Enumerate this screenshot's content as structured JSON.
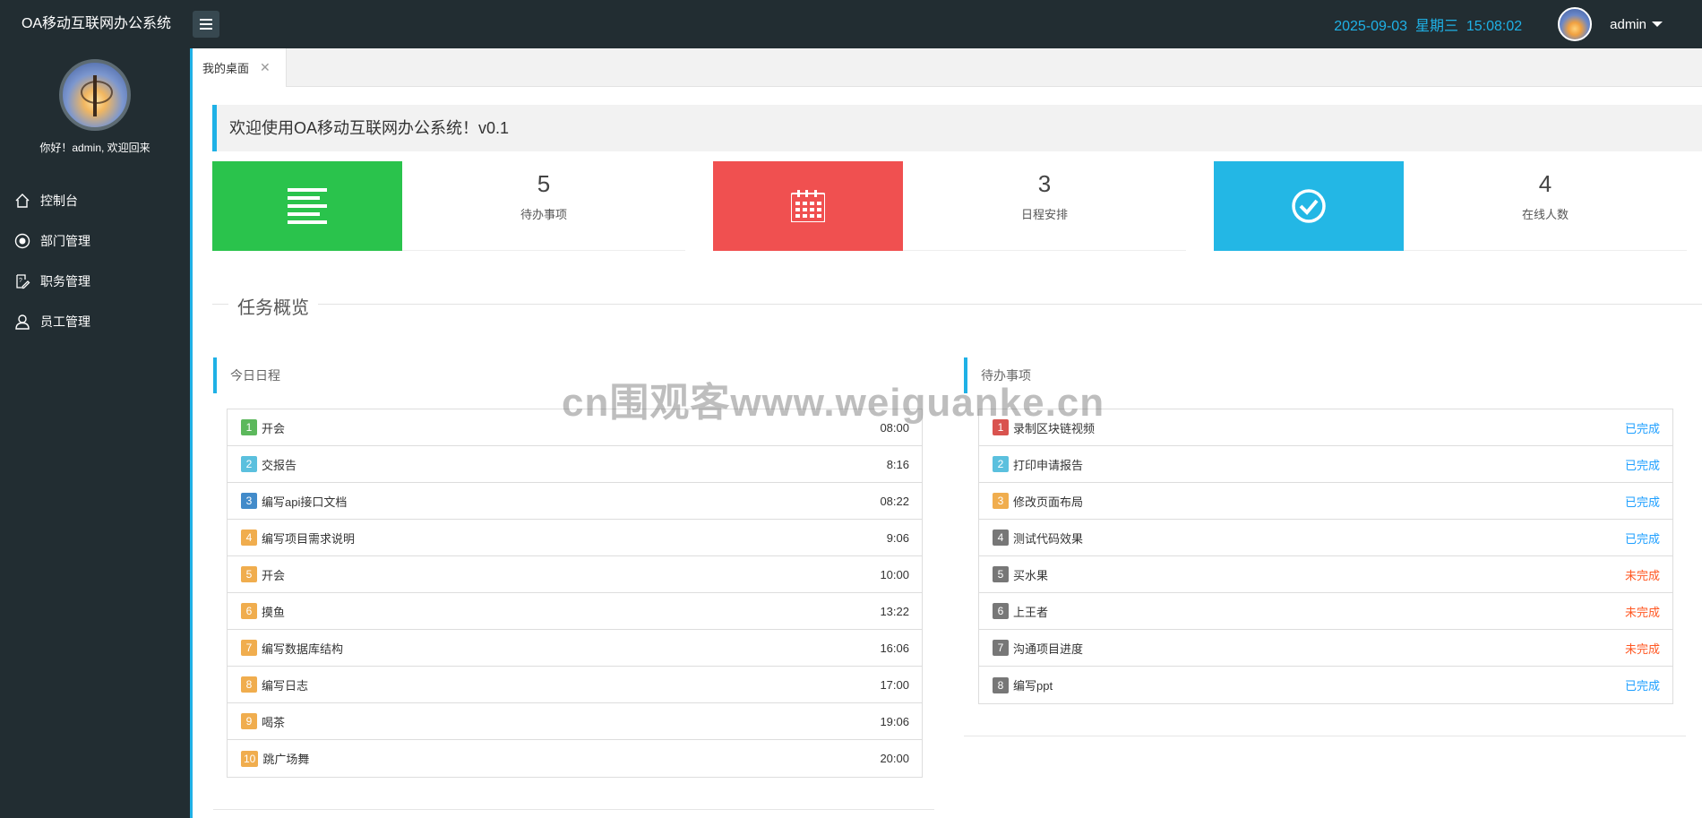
{
  "app": {
    "title": "OA移动互联网办公系统",
    "datetime": "2025-09-03  星期三  15:08:02",
    "user": "admin"
  },
  "sidebar": {
    "greeting": "你好！admin, 欢迎回来",
    "items": [
      {
        "label": "控制台",
        "icon": "home-icon"
      },
      {
        "label": "部门管理",
        "icon": "radio-icon"
      },
      {
        "label": "职务管理",
        "icon": "edit-doc-icon"
      },
      {
        "label": "员工管理",
        "icon": "user-icon"
      }
    ]
  },
  "tabs": [
    {
      "label": "我的桌面",
      "active": true
    }
  ],
  "main": {
    "welcome": "欢迎使用OA移动互联网办公系统！v0.1",
    "stats": [
      {
        "value": "5",
        "label": "待办事项",
        "color": "#2ac34c",
        "icon": "list-icon"
      },
      {
        "value": "3",
        "label": "日程安排",
        "color": "#f05050",
        "icon": "calendar-icon"
      },
      {
        "value": "4",
        "label": "在线人数",
        "color": "#23b7e5",
        "icon": "check-circle-icon"
      }
    ],
    "section_title": "任务概览",
    "schedule": {
      "title": "今日日程",
      "items": [
        {
          "n": "1",
          "text": "开会",
          "time": "08:00",
          "color": "#5cb85c"
        },
        {
          "n": "2",
          "text": "交报告",
          "time": "8:16",
          "color": "#5bc0de"
        },
        {
          "n": "3",
          "text": "编写api接口文档",
          "time": "08:22",
          "color": "#428bca"
        },
        {
          "n": "4",
          "text": "编写项目需求说明",
          "time": "9:06",
          "color": "#f0ad4e"
        },
        {
          "n": "5",
          "text": "开会",
          "time": "10:00",
          "color": "#f0ad4e"
        },
        {
          "n": "6",
          "text": "摸鱼",
          "time": "13:22",
          "color": "#f0ad4e"
        },
        {
          "n": "7",
          "text": "编写数据库结构",
          "time": "16:06",
          "color": "#f0ad4e"
        },
        {
          "n": "8",
          "text": "编写日志",
          "time": "17:00",
          "color": "#f0ad4e"
        },
        {
          "n": "9",
          "text": "喝茶",
          "time": "19:06",
          "color": "#f0ad4e"
        },
        {
          "n": "10",
          "text": "跳广场舞",
          "time": "20:00",
          "color": "#f0ad4e"
        }
      ]
    },
    "todo": {
      "title": "待办事项",
      "items": [
        {
          "n": "1",
          "text": "录制区块链视频",
          "status": "已完成",
          "color": "#d9534f",
          "status_color": "#1e9fff"
        },
        {
          "n": "2",
          "text": "打印申请报告",
          "status": "已完成",
          "color": "#5bc0de",
          "status_color": "#1e9fff"
        },
        {
          "n": "3",
          "text": "修改页面布局",
          "status": "已完成",
          "color": "#f0ad4e",
          "status_color": "#1e9fff"
        },
        {
          "n": "4",
          "text": "测试代码效果",
          "status": "已完成",
          "color": "#777777",
          "status_color": "#1e9fff"
        },
        {
          "n": "5",
          "text": "买水果",
          "status": "未完成",
          "color": "#777777",
          "status_color": "#ff5722"
        },
        {
          "n": "6",
          "text": "上王者",
          "status": "未完成",
          "color": "#777777",
          "status_color": "#ff5722"
        },
        {
          "n": "7",
          "text": "沟通项目进度",
          "status": "未完成",
          "color": "#777777",
          "status_color": "#ff5722"
        },
        {
          "n": "8",
          "text": "编写ppt",
          "status": "已完成",
          "color": "#777777",
          "status_color": "#1e9fff"
        }
      ]
    }
  },
  "watermark": "cn围观客www.weiguanke.cn"
}
